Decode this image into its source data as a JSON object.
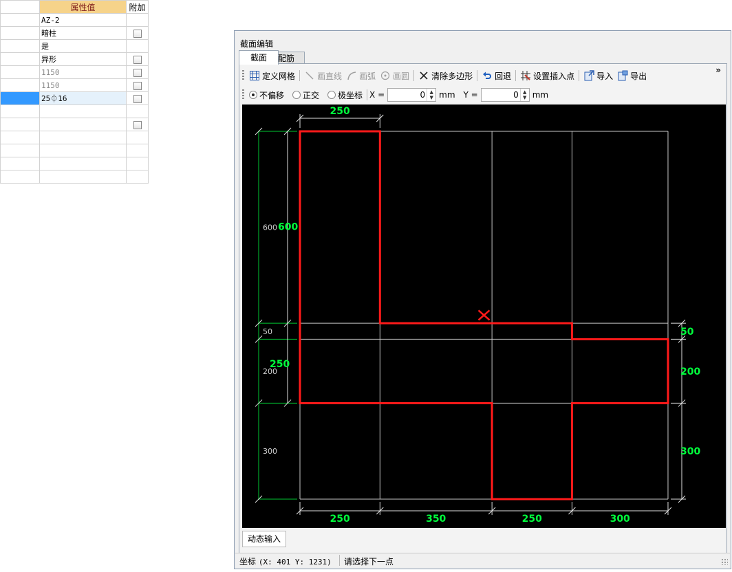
{
  "property_grid": {
    "headers": {
      "name": "",
      "value": "属性值",
      "extra": "附加"
    },
    "rows": [
      {
        "value": "AZ-2",
        "checkbox": false,
        "muted": false,
        "selected": false
      },
      {
        "value": "暗柱",
        "checkbox": true,
        "muted": false,
        "selected": false
      },
      {
        "value": "是",
        "checkbox": false,
        "muted": false,
        "selected": false
      },
      {
        "value": "异形",
        "checkbox": true,
        "muted": false,
        "selected": false
      },
      {
        "value": "1150",
        "checkbox": true,
        "muted": true,
        "selected": false
      },
      {
        "value": "1150",
        "checkbox": true,
        "muted": true,
        "selected": false
      },
      {
        "value": "25⏀16",
        "checkbox": true,
        "muted": false,
        "selected": true
      },
      {
        "value": "",
        "checkbox": false,
        "muted": false,
        "selected": false
      },
      {
        "value": "",
        "checkbox": true,
        "muted": false,
        "selected": false
      },
      {
        "value": "",
        "checkbox": false,
        "muted": false,
        "selected": false
      },
      {
        "value": "",
        "checkbox": false,
        "muted": false,
        "selected": false
      },
      {
        "value": "",
        "checkbox": false,
        "muted": false,
        "selected": false
      },
      {
        "value": "",
        "checkbox": false,
        "muted": false,
        "selected": false
      }
    ]
  },
  "dialog": {
    "title": "截面编辑",
    "tabs": [
      {
        "label": "截面",
        "active": true
      },
      {
        "label": "配筋",
        "active": false
      }
    ],
    "toolbar": {
      "define_grid": "定义网格",
      "draw_line": "画直线",
      "draw_arc": "画弧",
      "draw_circle": "画圆",
      "clear_polygon": "清除多边形",
      "undo": "回退",
      "set_insert_point": "设置插入点",
      "import": "导入",
      "export": "导出",
      "overflow": "»"
    },
    "input_bar": {
      "modes": [
        {
          "label": "不偏移",
          "selected": true
        },
        {
          "label": "正交",
          "selected": false
        },
        {
          "label": "极坐标",
          "selected": false
        }
      ],
      "x_label": "X =",
      "x_value": "0",
      "y_label": "Y =",
      "y_value": "0",
      "unit": "mm"
    },
    "canvas": {
      "colors": {
        "background": "#000000",
        "grid": "#c8c8c8",
        "polygon": "#ff1a1a",
        "dimension_text": "#00ff3c",
        "dimension_line": "#00c832",
        "ext_line": "#e0e0e0",
        "axis_text": "#d0d0d0"
      },
      "grid": {
        "x_spans": [
          250,
          350,
          250,
          300
        ],
        "y_spans": [
          600,
          50,
          200,
          300
        ]
      },
      "polygon_mm": [
        [
          0,
          0
        ],
        [
          250,
          0
        ],
        [
          250,
          600
        ],
        [
          850,
          600
        ],
        [
          850,
          650
        ],
        [
          1150,
          650
        ],
        [
          1150,
          850
        ],
        [
          850,
          850
        ],
        [
          850,
          1150
        ],
        [
          600,
          1150
        ],
        [
          600,
          850
        ],
        [
          0,
          850
        ]
      ],
      "insert_point_mm": [
        575,
        575
      ],
      "dimension_labels": {
        "top_span": "250",
        "bottom_spans": [
          "250",
          "350",
          "250",
          "300"
        ],
        "left_gray": [
          "600",
          "50",
          "200",
          "300"
        ],
        "left_green": [
          "600",
          "250"
        ],
        "right_spans": [
          "50",
          "200",
          "300"
        ]
      }
    },
    "dynamic_input_tab": "动态输入",
    "status_bar": {
      "coord_label": "坐标",
      "coord_value": "(X: 401 Y: 1231)",
      "message": "请选择下一点"
    }
  }
}
